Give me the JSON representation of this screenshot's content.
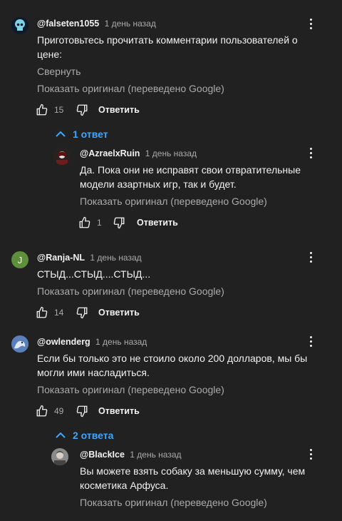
{
  "colors": {
    "background": "#212121",
    "text": "#f1f1f1",
    "secondary": "#aaaaaa",
    "accent": "#3ea6ff"
  },
  "comments": [
    {
      "author": "@falseten1055",
      "time": "1 день назад",
      "text": "Приготовьтесь прочитать комментарии пользователей о цене:",
      "collapse": "Свернуть",
      "show_original": "Показать оригинал (переведено Google)",
      "likes": "15",
      "reply_label": "Ответить",
      "replies_toggle": "1 ответ"
    },
    {
      "author": "@AzraelxRuin",
      "time": "1 день назад",
      "text_line1": "Да. Пока они не исправят свои отвратительные",
      "text_line2": "модели азартных игр, так и будет.",
      "show_original": "Показать оригинал (переведено Google)",
      "likes": "1",
      "reply_label": "Ответить"
    },
    {
      "author": "@Ranja-NL",
      "avatar_letter": "J",
      "time": "1 день назад",
      "text": "СТЫД...СТЫД....СТЫД...",
      "show_original": "Показать оригинал (переведено Google)",
      "likes": "14",
      "reply_label": "Ответить"
    },
    {
      "author": "@owlenderg",
      "time": "1 день назад",
      "text_line1": "Если бы только это не стоило около 200 долларов, мы бы",
      "text_line2": "могли ими насладиться.",
      "show_original": "Показать оригинал (переведено Google)",
      "likes": "49",
      "reply_label": "Ответить",
      "replies_toggle": "2 ответа"
    },
    {
      "author": "@BlackIce",
      "time": "1 день назад",
      "text_line1": "Вы можете взять собаку за меньшую сумму, чем",
      "text_line2": "косметика Арфуса.",
      "show_original": "Показать оригинал (переведено Google)"
    }
  ]
}
